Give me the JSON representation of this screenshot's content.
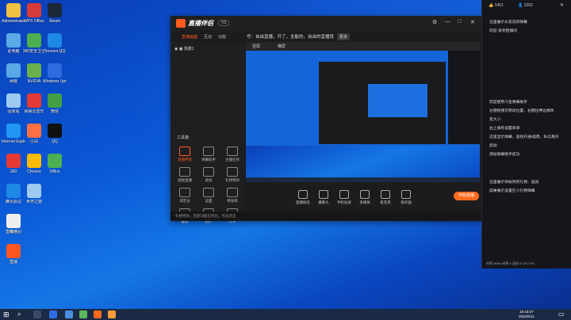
{
  "desktop_icons": [
    {
      "label": "Administrator",
      "color": "#f0c040"
    },
    {
      "label": "WPS Office",
      "color": "#d83a3a"
    },
    {
      "label": "Steam",
      "color": "#1b2838"
    },
    {
      "label": "此电脑",
      "color": "#5aa9e6"
    },
    {
      "label": "360安全卫士",
      "color": "#4caf50"
    },
    {
      "label": "Tencent QQ",
      "color": "#1e88e5"
    },
    {
      "label": "网络",
      "color": "#5aa9e6"
    },
    {
      "label": "NVIDIA",
      "color": "#6ab04c"
    },
    {
      "label": "Windows Update",
      "color": "#2d6cdf"
    },
    {
      "label": "回收站",
      "color": "#9ec9f0"
    },
    {
      "label": "网易云音乐",
      "color": "#e53935"
    },
    {
      "label": "微信",
      "color": "#43a047"
    },
    {
      "label": "Internet Explorer",
      "color": "#2196f3"
    },
    {
      "label": "小白",
      "color": "#ff7043"
    },
    {
      "label": "QQ",
      "color": "#111111"
    },
    {
      "label": "360",
      "color": "#e53935"
    },
    {
      "label": "Chrome",
      "color": "#fbbc05"
    },
    {
      "label": "Office",
      "color": "#4caf50"
    },
    {
      "label": "腾讯会议",
      "color": "#1e88e5"
    },
    {
      "label": "世界之窗",
      "color": "#9ec9f0"
    },
    {
      "label": "直播伴侣",
      "color": "#f5c518"
    },
    {
      "label": "微信",
      "color": "#eeeeee"
    },
    {
      "label": "直播",
      "color": "#ff5722"
    }
  ],
  "app": {
    "title": "直播伴侣",
    "version_badge": "V5",
    "tabs": [
      "直播画面",
      "互动",
      "功能"
    ],
    "notice": "号：自由直播，开了，全能的，自由的直播员",
    "notice_btn": "更多",
    "scene_label": "场景1",
    "preview_tabs": [
      "竖屏",
      "横屏"
    ],
    "toolbox_title": "工具箱",
    "tools": [
      "直播伴侣",
      "弹幕助手",
      "主播任务",
      "视频直播",
      "录屏",
      "礼物特效",
      "调音台",
      "设置",
      "特效库",
      "截图",
      "图片",
      "文字"
    ],
    "bottom_buttons": [
      "直播排名",
      "摄像头",
      "手机投屏",
      "多媒体",
      "麦克风",
      "扬声器"
    ],
    "start_live": "开始直播",
    "status_text": "礼物特效，连麦功能已开启，点击开启"
  },
  "chat": {
    "likes": "1461",
    "viewers": "2392",
    "lines_top": [
      "这里展示水友说的弹幕",
      "欢迎 来到直播间"
    ],
    "lines_mid": [
      "欢迎使用斗鱼弹幕助手",
      "左键拖拽可移动位置，右键拉伸边缘改",
      "变大小",
      "右上角有设置简单",
      "这里显示弹幕，查找开通/续费，私信再开",
      "启动",
      "添加弹幕助手成功"
    ],
    "lines_bottom": [
      "这里展示你收到的礼物、道具",
      "成果展示设置在小礼物弹幕"
    ],
    "footer": "码率 0Kb/s  帧率 0  丢帧 0  CPU 0%"
  },
  "taskbar": {
    "time": "15:43:37",
    "date": "2022/6/11"
  }
}
